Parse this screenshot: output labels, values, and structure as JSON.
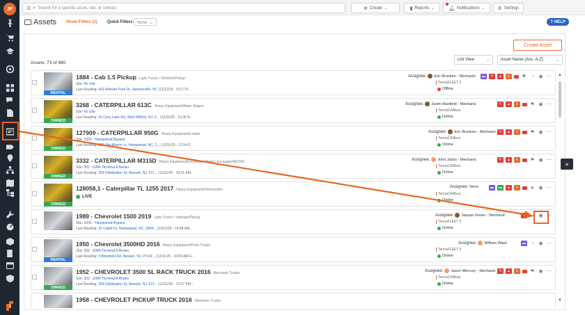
{
  "user": {
    "initials": "JF"
  },
  "topbar": {
    "search_placeholder": "Search for a specific asset, site, or contact",
    "create": "Create",
    "reports": "Reports",
    "notifications": "Notifications",
    "settings": "Settings"
  },
  "header": {
    "title": "Assets",
    "show_filters": "Show Filters (1)",
    "quick_filters_label": "Quick Filters:",
    "quick_filters_value": "None",
    "help": "HELP"
  },
  "main": {
    "create_asset": "Create Asset",
    "asset_count": "Assets: 73 of 980",
    "list_view": "List View",
    "sort": "Asset Name (Asc. A-Z)"
  },
  "colors": {
    "accent": "#e96a2f",
    "rental": "#2f7bd8",
    "owned": "#39a750",
    "help": "#2b64c6",
    "sidebar": "#1e2730"
  },
  "assets": [
    {
      "name": "1884 - Cab 1.5 Pickup",
      "category": "Light Trucks / Vehicles/Pickup",
      "badge": "RENTAL",
      "site_label": "Site:",
      "site": "No Site",
      "reading_label": "Last Reading:",
      "reading": "419 Wonder Park Dr, Jacksonville, NC",
      "reading_time": "(12/12/25 - 03:17 P...",
      "assignee_label": "Assignee:",
      "assignee": "Eric Brunken - Mechanic",
      "telematics": "TennaFLEET II",
      "status": "Offline"
    },
    {
      "name": "3268 - CATERPILLAR 613C",
      "category": "Heavy Equipment/Water Wagon",
      "badge": "OWNED",
      "site_label": "Site:",
      "site": "No Site",
      "reading_label": "Last Reading:",
      "reading": "16 Cozy Lake Rd, West Milford, NJ, 0...",
      "reading_time": "(12/11/25 - 10:36 A...",
      "assignee_label": "Assignee:",
      "assignee": "Justin Maxfield - Mechanic",
      "telematics": "TennaCANbus",
      "status": "Online"
    },
    {
      "name": "127909 - CATERPILLAR 950G",
      "category": "Heavy Equipment/Loader",
      "badge": "OWNED",
      "site_label": "Site:",
      "site": "1003 - Hampstead Bypass",
      "reading_label": "Last Reading:",
      "reading": "135 Tim Moore Ln, Hampstead, NC, 2...",
      "reading_time": "(12/11/25 - 12:54 P...",
      "assignee_label": "Assignee:",
      "assignee": "Eric Brunken - Mechanic",
      "telematics": "TennaCANbus",
      "status": "Online"
    },
    {
      "name": "3332 - CATERPILLAR M315D",
      "category": "Heavy Equipment/Excavator Wheel / Excavator/M315D",
      "badge": "OWNED",
      "site_label": "Site:",
      "site": "302 - EWR Terminal A Redev",
      "reading_label": "Last Reading:",
      "reading": "269 Distribution St, Newark, NJ, 071...",
      "reading_time": "(12/11/25 - 10:31 AM...",
      "assignee_label": "Assignee:",
      "assignee": "John Jacks - Mechanic",
      "telematics": "TennaCANbus",
      "status": "Online"
    },
    {
      "name": "128058,1 - Caterpillar TL 1255 2017",
      "category": "Heavy Equipment/Telehandler",
      "badge": "OWNED",
      "live": "LIVE",
      "assignee_label": "Assignee:",
      "assignee": "None",
      "telematics": "TennaCANbus",
      "status": "Online"
    },
    {
      "name": "1989 - Chevrolet 1500 2019",
      "category": "Light Trucks / Vehicles/Pickup",
      "badge": "",
      "site_label": "Site:",
      "site": "1002 - Hampstead Bypass",
      "reading_label": "Last Reading:",
      "reading": "31 Cabot Dr, Hampstead, NC, 2844...",
      "reading_time": "(12/11/25 - 10:48 AM...",
      "assignee_label": "Assignee:",
      "assignee": "Jaquan Green - Mechanic",
      "telematics": "TennaFLEET II",
      "status": "Online"
    },
    {
      "name": "1950 - Chevrolet 3500HD 2016",
      "category": "Heavy Equipment/Parts Trucks",
      "badge": "RENTAL",
      "site_label": "Site:",
      "site": "302 - EWR Terminal A Redev",
      "reading_label": "Last Reading:",
      "reading": "3 Brinsfield Rd, Newark, NJ, 07114...",
      "reading_time": "(12/11/25 - 10:59 AM E...",
      "assignee_label": "Assignee:",
      "assignee": "William Ward",
      "telematics": "TennaFLEET II",
      "status": "Online"
    },
    {
      "name": "1952 - CHEVROLET 3500 SL RACK TRUCK 2016",
      "category": "Mechanic Trucks",
      "badge": "OWNED",
      "site_label": "Site:",
      "site": "302 - EWR Terminal A Redev",
      "reading_label": "Last Reading:",
      "reading": "269 Distribution St, Newark, NJ, 071...",
      "reading_time": "(12/11/25 - 12:27 PM...",
      "assignee_label": "Assignee:",
      "assignee": "Jason Mercury - Mechanic",
      "telematics": "TennaCANbus",
      "status": "Online"
    },
    {
      "name": "1958 - CHEVROLET PICKUP TRUCK 2016",
      "category": "Mechanic Trucks",
      "badge": "",
      "assignee_label": "Assignee:",
      "assignee": "",
      "telematics": "",
      "status": ""
    }
  ]
}
